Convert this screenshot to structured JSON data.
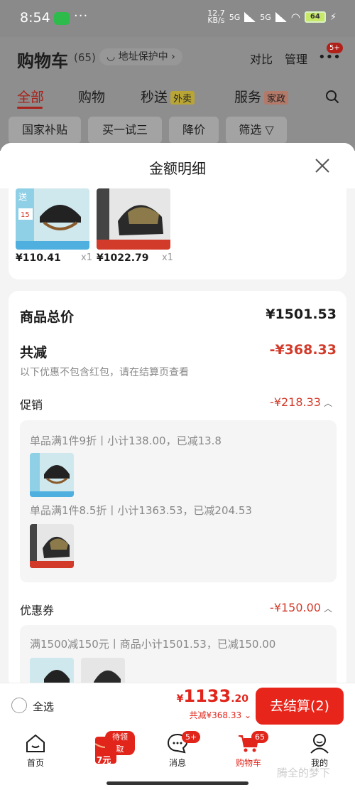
{
  "status": {
    "time": "8:54",
    "dots": "···",
    "net_speed_top": "12.7",
    "net_speed_bottom": "KB/s",
    "sig1": "5G",
    "sig2": "5G",
    "battery": "64"
  },
  "header": {
    "title": "购物车",
    "count": "(65)",
    "address": "地址保护中 ›",
    "compare": "对比",
    "manage": "管理",
    "more_badge": "5+"
  },
  "tabs": [
    {
      "label": "全部"
    },
    {
      "label": "购物"
    },
    {
      "label": "秒送",
      "tag": "外卖"
    },
    {
      "label": "服务",
      "tag": "家政"
    }
  ],
  "chips": [
    "国家补贴",
    "买一试三",
    "降价",
    "筛选 ▽"
  ],
  "sheet": {
    "title": "金额明细",
    "products": [
      {
        "price": "¥110.41",
        "qty": "x1"
      },
      {
        "price": "¥1022.79",
        "qty": "x1"
      }
    ],
    "total_label": "商品总价",
    "total_value": "¥1501.53",
    "discount_label": "共减",
    "discount_value": "-¥368.33",
    "discount_note": "以下优惠不包含红包，请在结算页查看",
    "promo_label": "促销",
    "promo_value": "-¥218.33",
    "promo_lines": [
      "单品满1件9折丨小计138.00，已减13.8",
      "单品满1件8.5折丨小计1363.53，已减204.53"
    ],
    "coupon_label": "优惠券",
    "coupon_value": "-¥150.00",
    "coupon_line": "满1500减150元丨商品小计1501.53，已减150.00"
  },
  "checkout": {
    "select_all": "全选",
    "yen": "¥",
    "total_int": "1133",
    "total_dec": ".20",
    "saved": "共减¥368.33 ⌄",
    "button": "去结算(2)"
  },
  "tabbar": [
    {
      "label": "首页"
    },
    {
      "label": "",
      "badge": "待领取",
      "sub": "7元"
    },
    {
      "label": "消息",
      "badge": "5+"
    },
    {
      "label": "购物车",
      "badge": "65"
    },
    {
      "label": "我的"
    }
  ],
  "watermark": "腾全的梦下",
  "colors": {
    "accent": "#e1251b",
    "discount": "#d23a2a"
  }
}
